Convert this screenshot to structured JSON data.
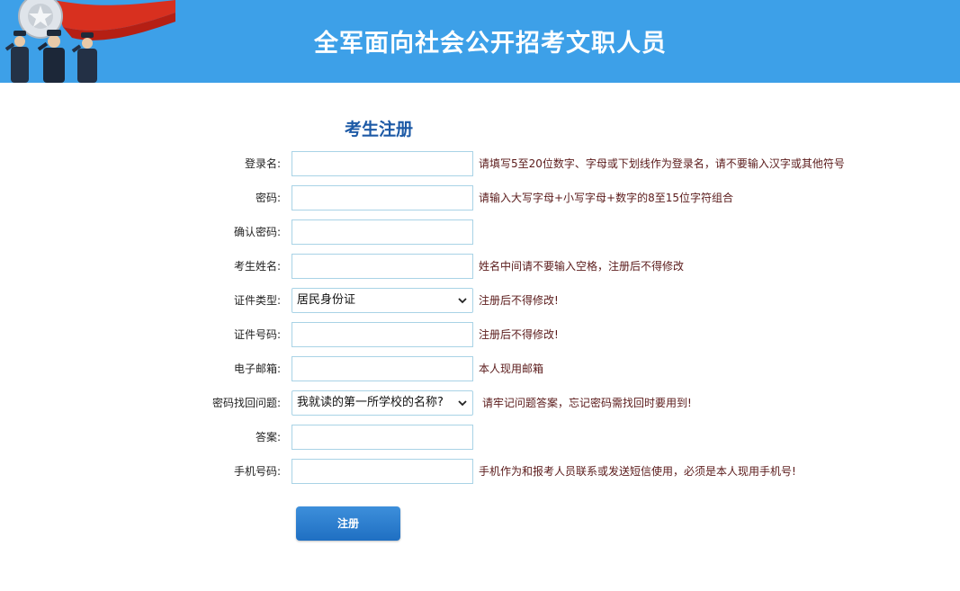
{
  "header": {
    "banner_title": "全军面向社会公开招考文职人员",
    "background_color": "#3da0e8"
  },
  "page_title": "考生注册",
  "form": {
    "fields": [
      {
        "label": "登录名:",
        "type": "text",
        "value": "",
        "hint": "请填写5至20位数字、字母或下划线作为登录名，请不要输入汉字或其他符号"
      },
      {
        "label": "密码:",
        "type": "password",
        "value": "",
        "hint": "请输入大写字母+小写字母+数字的8至15位字符组合"
      },
      {
        "label": "确认密码:",
        "type": "password",
        "value": "",
        "hint": ""
      },
      {
        "label": "考生姓名:",
        "type": "text",
        "value": "",
        "hint": "姓名中间请不要输入空格，注册后不得修改"
      },
      {
        "label": "证件类型:",
        "type": "select",
        "value": "居民身份证",
        "hint": "注册后不得修改!"
      },
      {
        "label": "证件号码:",
        "type": "text",
        "value": "",
        "hint": "注册后不得修改!"
      },
      {
        "label": "电子邮箱:",
        "type": "text",
        "value": "",
        "hint": "本人现用邮箱"
      },
      {
        "label": "密码找回问题:",
        "type": "select",
        "value": "我就读的第一所学校的名称?",
        "hint": "请牢记问题答案，忘记密码需找回时要用到!"
      },
      {
        "label": "答案:",
        "type": "text",
        "value": "",
        "hint": ""
      },
      {
        "label": "手机号码:",
        "type": "text",
        "value": "",
        "hint": "手机作为和报考人员联系或发送短信使用，必须是本人现用手机号!"
      }
    ]
  },
  "submit_label": "注册",
  "colors": {
    "accent": "#1f6fc2",
    "title": "#1d5aa6",
    "hint_text": "#5a1a1a",
    "field_border": "#a9d3e6"
  },
  "icons": {
    "emblem": "army-emblem-with-soldiers",
    "select_arrow": "chevron-down-icon"
  }
}
